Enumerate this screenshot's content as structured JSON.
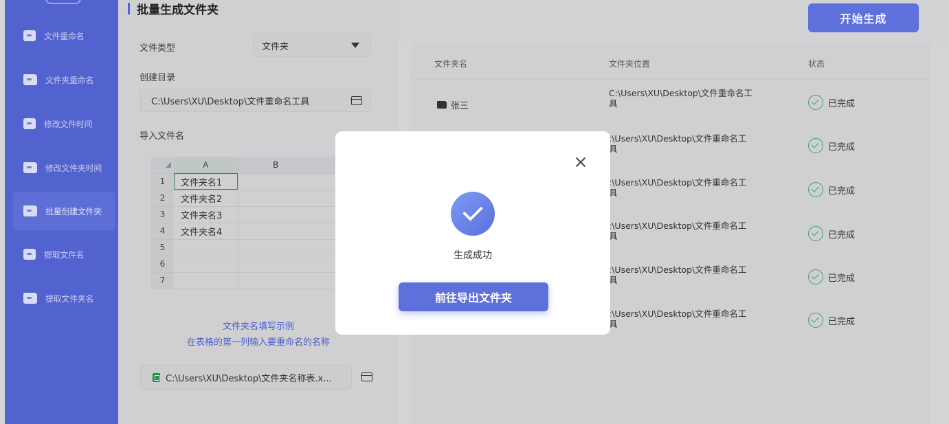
{
  "sidebar": {
    "items": [
      {
        "label": "文件重命名"
      },
      {
        "label": "文件夹重命名"
      },
      {
        "label": "修改文件时间"
      },
      {
        "label": "修改文件夹时间"
      },
      {
        "label": "批量创建文件夹"
      },
      {
        "label": "提取文件名"
      },
      {
        "label": "提取文件夹名"
      }
    ],
    "active_index": 4
  },
  "left": {
    "title": "批量生成文件夹",
    "file_type_label": "文件类型",
    "file_type_value": "文件夹",
    "create_dir_label": "创建目录",
    "create_dir_path": "C:\\Users\\XU\\Desktop\\文件重命名工具",
    "import_label": "导入文件名",
    "sheet": {
      "col_headers": [
        "A",
        "B"
      ],
      "rows": [
        {
          "num": "1",
          "a": "文件夹名1"
        },
        {
          "num": "2",
          "a": "文件夹名2"
        },
        {
          "num": "3",
          "a": "文件夹名3"
        },
        {
          "num": "4",
          "a": "文件夹名4"
        },
        {
          "num": "5",
          "a": ""
        },
        {
          "num": "6",
          "a": ""
        },
        {
          "num": "7",
          "a": ""
        }
      ]
    },
    "hint_line1": "文件夹名填写示例",
    "hint_line2": "在表格的第一列输入要重命名的名称",
    "import_file_path": "C:\\Users\\XU\\Desktop\\文件夹名称表.x..."
  },
  "right": {
    "start_button": "开始生成",
    "headers": {
      "name": "文件夹名",
      "location": "文件夹位置",
      "status": "状态"
    },
    "rows": [
      {
        "name": "张三",
        "location_line1": "C:\\Users\\XU\\Desktop\\文件重命名工",
        "location_line2": "具",
        "status": "已完成"
      },
      {
        "name": "",
        "location_line1": ":\\Users\\XU\\Desktop\\文件重命名工",
        "location_line2": "具",
        "status": "已完成"
      },
      {
        "name": "",
        "location_line1": ":\\Users\\XU\\Desktop\\文件重命名工",
        "location_line2": "具",
        "status": "已完成"
      },
      {
        "name": "",
        "location_line1": ":\\Users\\XU\\Desktop\\文件重命名工",
        "location_line2": "具",
        "status": "已完成"
      },
      {
        "name": "",
        "location_line1": ":\\Users\\XU\\Desktop\\文件重命名工",
        "location_line2": "具",
        "status": "已完成"
      },
      {
        "name": "",
        "location_line1": ":\\Users\\XU\\Desktop\\文件重命名工",
        "location_line2": "具",
        "status": "已完成"
      }
    ]
  },
  "modal": {
    "message": "生成成功",
    "button": "前往导出文件夹"
  },
  "colors": {
    "accent": "#5d70db",
    "sidebar": "#5263cf",
    "success": "#39a563"
  },
  "icons": [
    "file-icon",
    "folder-icon",
    "clock-icon",
    "folder-add-icon",
    "extract-icon",
    "folder-open-icon",
    "excel-icon",
    "check-circle-icon",
    "close-icon",
    "success-check-icon",
    "dropdown-caret-icon"
  ]
}
